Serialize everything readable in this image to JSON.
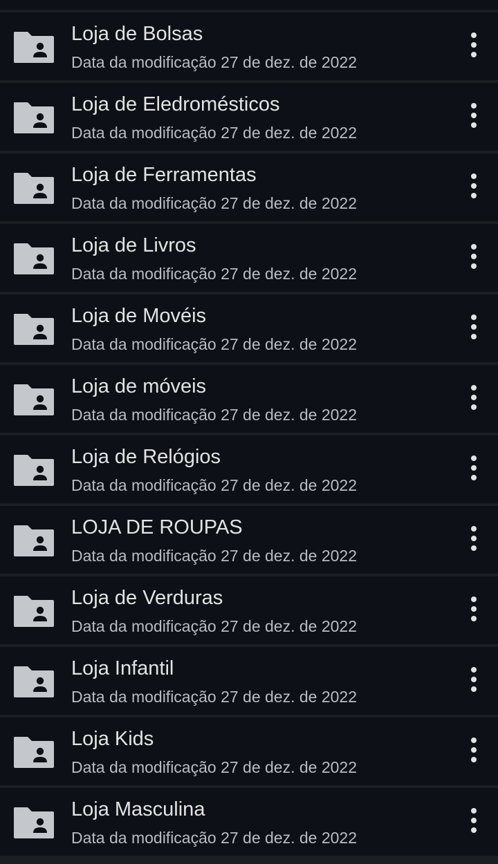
{
  "files": {
    "items": [
      {
        "name": "Loja de Bolsas",
        "subtitle": "Data da modificação 27 de dez. de 2022",
        "icon": "shared-folder-icon"
      },
      {
        "name": "Loja de Eledromésticos",
        "subtitle": "Data da modificação 27 de dez. de 2022",
        "icon": "shared-folder-icon"
      },
      {
        "name": "Loja de Ferramentas",
        "subtitle": "Data da modificação 27 de dez. de 2022",
        "icon": "shared-folder-icon"
      },
      {
        "name": "Loja de Livros",
        "subtitle": "Data da modificação 27 de dez. de 2022",
        "icon": "shared-folder-icon"
      },
      {
        "name": "Loja de Movéis",
        "subtitle": "Data da modificação 27 de dez. de 2022",
        "icon": "shared-folder-icon"
      },
      {
        "name": "Loja de móveis",
        "subtitle": "Data da modificação 27 de dez. de 2022",
        "icon": "shared-folder-icon"
      },
      {
        "name": "Loja de Relógios",
        "subtitle": "Data da modificação 27 de dez. de 2022",
        "icon": "shared-folder-icon"
      },
      {
        "name": "LOJA DE ROUPAS",
        "subtitle": "Data da modificação 27 de dez. de 2022",
        "icon": "shared-folder-icon"
      },
      {
        "name": "Loja de Verduras",
        "subtitle": "Data da modificação 27 de dez. de 2022",
        "icon": "shared-folder-icon"
      },
      {
        "name": "Loja Infantil",
        "subtitle": "Data da modificação 27 de dez. de 2022",
        "icon": "shared-folder-icon"
      },
      {
        "name": "Loja Kids",
        "subtitle": "Data da modificação 27 de dez. de 2022",
        "icon": "shared-folder-icon"
      },
      {
        "name": "Loja Masculina",
        "subtitle": "Data da modificação 27 de dez. de 2022",
        "icon": "shared-folder-icon"
      }
    ],
    "more_icon": "more-vert-icon"
  },
  "colors": {
    "row_background": "#0d1117",
    "divider": "#1b1f23",
    "title_text": "#e3e3e3",
    "subtitle_text": "#b9bcc1",
    "folder_icon": "#c4c7cc"
  }
}
